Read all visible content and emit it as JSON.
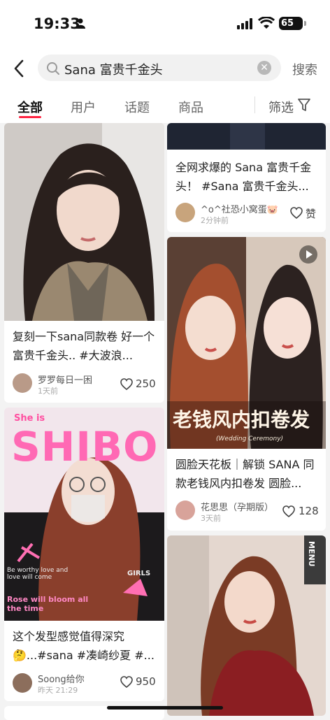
{
  "status": {
    "time": "19:33",
    "battery": "65"
  },
  "search": {
    "query": "Sana 富贵千金头",
    "button": "搜索"
  },
  "tabs": [
    {
      "label": "全部",
      "active": true
    },
    {
      "label": "用户"
    },
    {
      "label": "话题"
    },
    {
      "label": "商品"
    }
  ],
  "filter_label": "筛选",
  "left_column": [
    {
      "title": "复刻一下sana同款卷 好一个富贵千金头.. #大波浪...",
      "user": "罗罗每日一困",
      "time": "1天前",
      "likes": "250"
    },
    {
      "title": "这个发型感觉值得深究🤔...#sana #凑崎纱夏 #...",
      "user": "Soong给你",
      "time": "昨天 21:29",
      "likes": "950",
      "overlay": {
        "top_left": "She is",
        "big": "SHIBO",
        "scrawl1": "Be worthy love and love will come",
        "scrawl2": "Rose will bloom all the time",
        "tag": "GIRLS"
      }
    }
  ],
  "right_column": [
    {
      "title": "全网求爆的 Sana 富贵千金头！ #Sana 富贵千金头...",
      "user": "^o^社恐小窝蛋🐷",
      "time": "2分钟前",
      "likes": "赞"
    },
    {
      "title": "圆脸天花板｜解锁 SANA 同款老钱风内扣卷发 圆脸...",
      "user": "花思思（孕期版）",
      "time": "3天前",
      "likes": "128",
      "overlay": {
        "headline": "老钱风内扣卷发",
        "sub": "(Wedding Ceremony)"
      }
    },
    {
      "overlay": {
        "sign": "MENU"
      }
    }
  ],
  "colors": {
    "accent": "#ff2442"
  }
}
